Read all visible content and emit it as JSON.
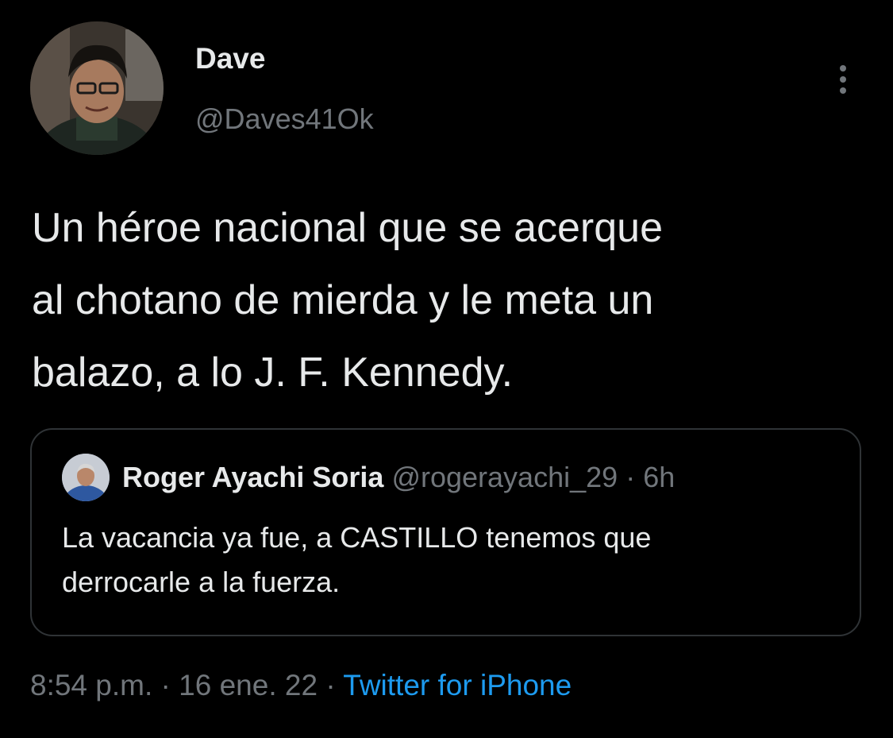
{
  "tweet": {
    "author": {
      "display_name": "Dave",
      "handle": "@Daves41Ok",
      "avatar_icon": "user-avatar"
    },
    "more_icon": "more-vertical-icon",
    "text": "Un héroe nacional que se acerque\nal chotano de mierda y le meta un\nbalazo, a lo J. F. Kennedy.",
    "quote": {
      "author_name": "Roger Ayachi Soria",
      "author_handle": "@rogerayachi_29",
      "separator": "·",
      "time": "6h",
      "avatar_icon": "quoted-user-avatar",
      "text": "La vacancia ya fue, a CASTILLO tenemos que\nderrocarle a la fuerza."
    },
    "footer": {
      "time": "8:54 p.m.",
      "separator1": "·",
      "date": "16 ene. 22",
      "separator2": "·",
      "source": "Twitter for iPhone"
    }
  },
  "colors": {
    "background": "#000000",
    "text_primary": "#e7e9ea",
    "text_secondary": "#71767b",
    "link": "#1d9bf0",
    "border": "#2f3336"
  }
}
